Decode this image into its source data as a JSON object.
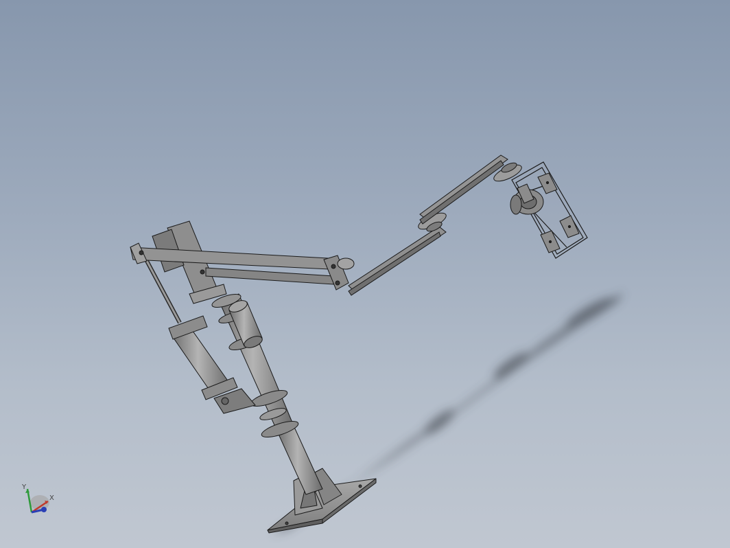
{
  "viewport": {
    "background_top": "#8797ad",
    "background_bottom": "#c0c7d1"
  },
  "model": {
    "part_color": "#8f8f8f",
    "edge_color": "#1a1a1a",
    "shadow_color": "#3a3f47"
  },
  "triad": {
    "x_label": "X",
    "y_label": "Y",
    "x_color": "#c0392b",
    "y_color": "#2e9a3a",
    "z_color": "#2a3fb5"
  }
}
